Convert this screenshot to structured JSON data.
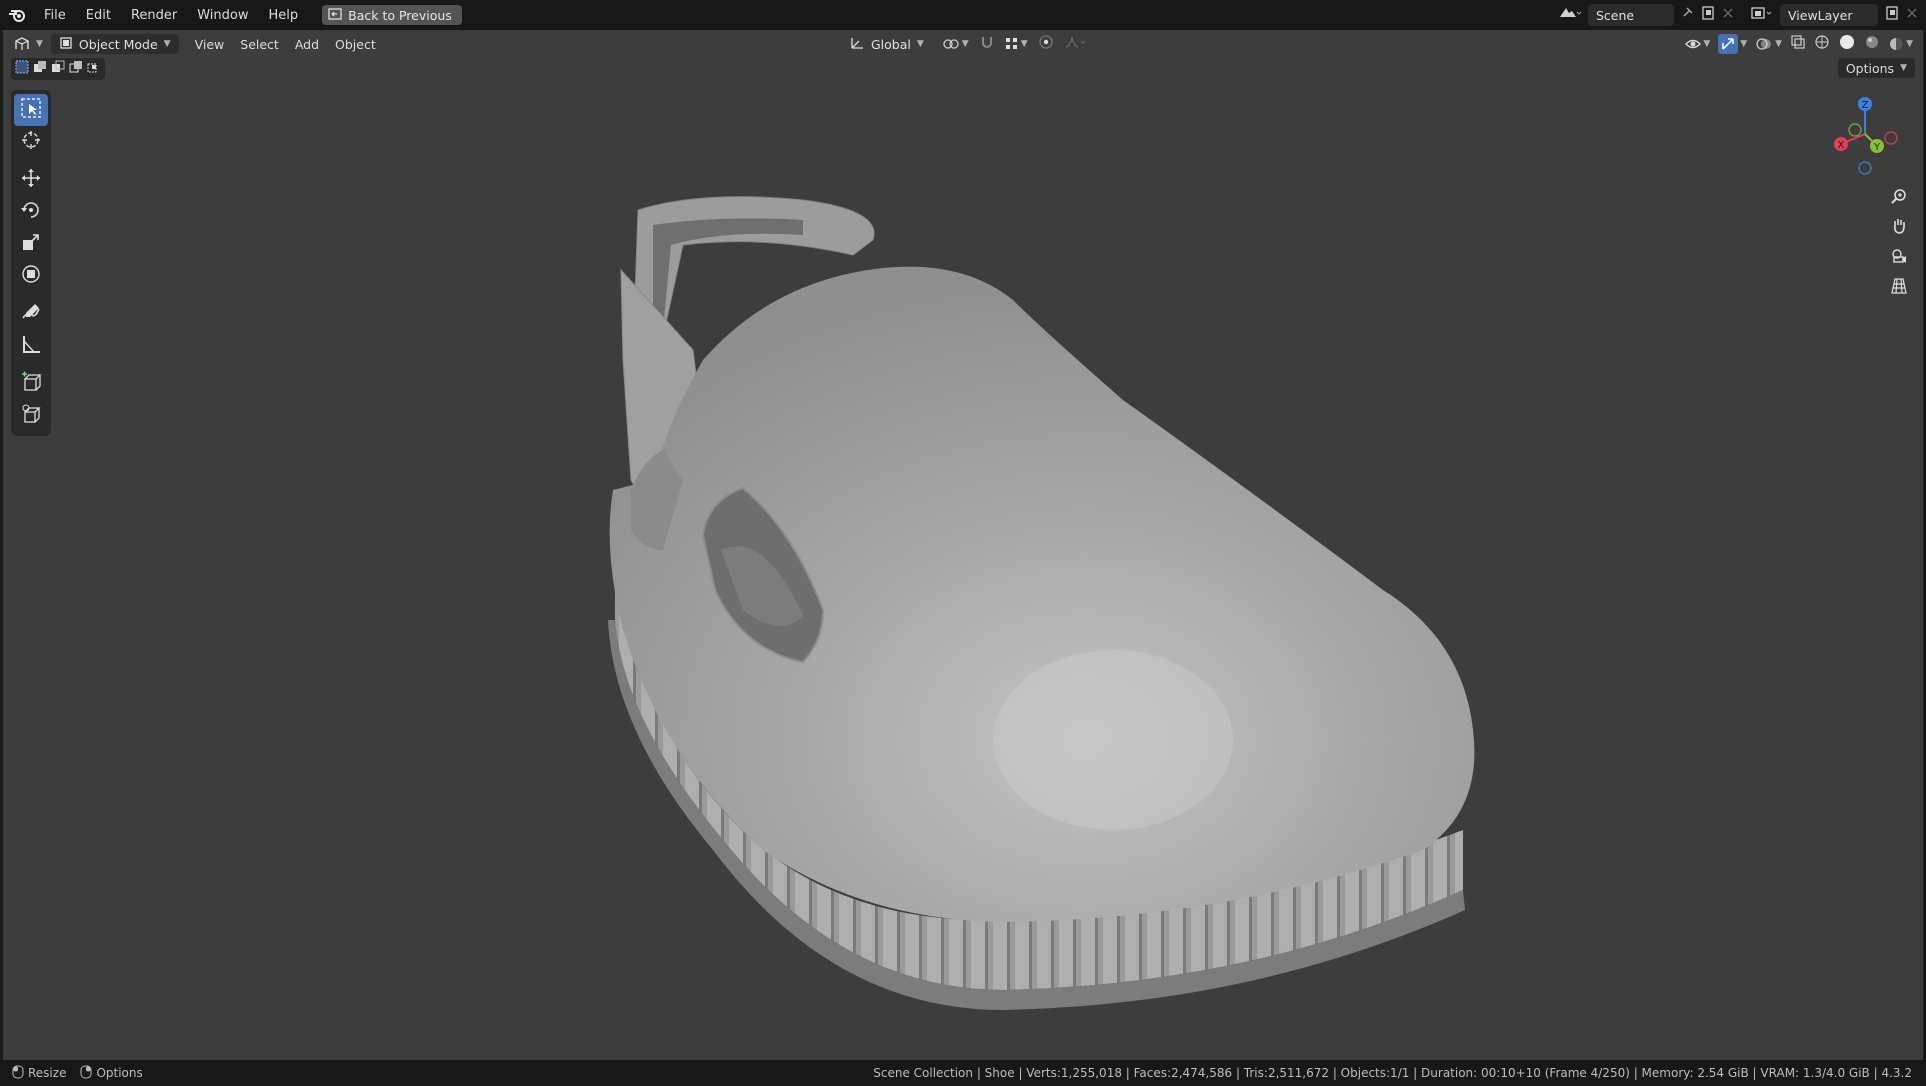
{
  "menu": {
    "items": [
      "File",
      "Edit",
      "Render",
      "Window",
      "Help"
    ],
    "back_button": "Back to Previous"
  },
  "top_right": {
    "scene_label": "Scene",
    "viewlayer_label": "ViewLayer"
  },
  "viewport_header": {
    "mode": "Object Mode",
    "menus": [
      "View",
      "Select",
      "Add",
      "Object"
    ],
    "transform_orientation": "Global",
    "options_label": "Options"
  },
  "gizmo": {
    "x_label": "X",
    "y_label": "Y",
    "z_label": "Z"
  },
  "status": {
    "left_items": [
      "Resize",
      "Options"
    ],
    "stats": "Scene Collection | Shoe | Verts:1,255,018 | Faces:2,474,586 | Tris:2,511,672 | Objects:1/1 | Duration: 00:10+10 (Frame 4/250) | Memory: 2.54 GiB | VRAM: 1.3/4.0 GiB | 4.3.2"
  },
  "colors": {
    "accent": "#4772b3",
    "axis_x": "#e0405b",
    "axis_y": "#86c03a",
    "axis_z": "#3b82e0"
  }
}
